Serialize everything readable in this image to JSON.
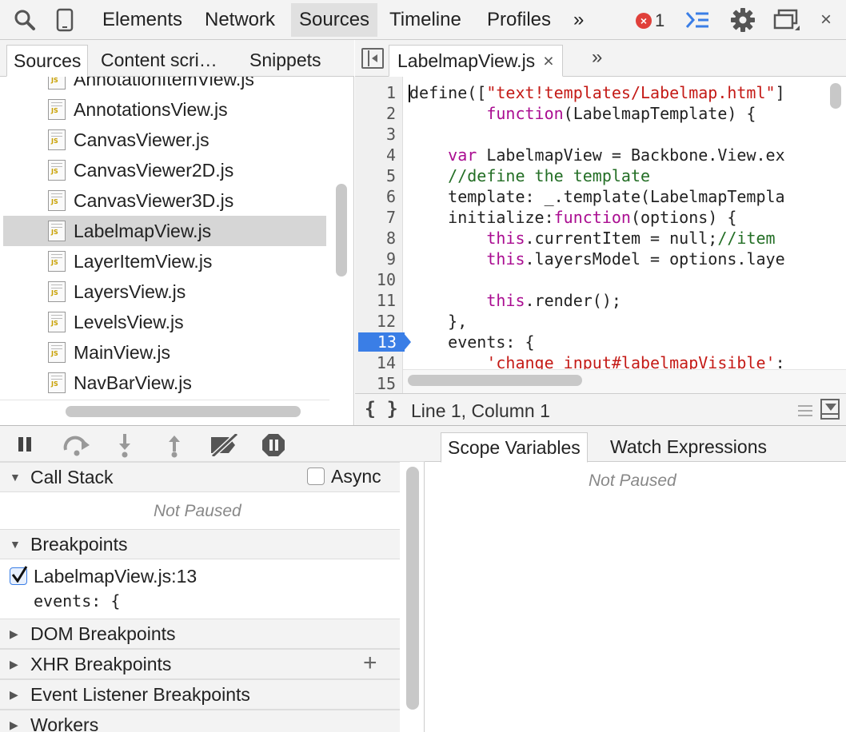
{
  "toolbar": {
    "tabs": [
      "Elements",
      "Network",
      "Sources",
      "Timeline",
      "Profiles"
    ],
    "active_tab": "Sources",
    "more": "»",
    "error_count": "1",
    "error_glyph": "×",
    "close": "×"
  },
  "navigator": {
    "tabs": [
      "Sources",
      "Content scri…",
      "Snippets"
    ],
    "files": [
      "AnnotationItemView.js",
      "AnnotationsView.js",
      "CanvasViewer.js",
      "CanvasViewer2D.js",
      "CanvasViewer3D.js",
      "LabelmapView.js",
      "LayerItemView.js",
      "LayersView.js",
      "LevelsView.js",
      "MainView.js",
      "NavBarView.js"
    ],
    "selected_file": "LabelmapView.js"
  },
  "editor": {
    "open_tab": "LabelmapView.js",
    "tab_close": "×",
    "more": "»",
    "line_numbers": [
      "1",
      "2",
      "3",
      "4",
      "5",
      "6",
      "7",
      "8",
      "9",
      "10",
      "11",
      "12",
      "13",
      "14",
      "15"
    ],
    "breakpoint_line": "13",
    "status": "Line 1, Column 1",
    "pretty_print": "{ }"
  },
  "debugger": {
    "call_stack": "Call Stack",
    "async_label": "Async",
    "not_paused": "Not Paused",
    "breakpoints": "Breakpoints",
    "breakpoint_location": "LabelmapView.js:13",
    "breakpoint_code": "events: {",
    "dom_breakpoints": "DOM Breakpoints",
    "xhr_breakpoints": "XHR Breakpoints",
    "xhr_add": "+",
    "event_listener_breakpoints": "Event Listener Breakpoints",
    "workers": "Workers"
  },
  "scope": {
    "tabs": [
      "Scope Variables",
      "Watch Expressions"
    ],
    "not_paused": "Not Paused"
  }
}
